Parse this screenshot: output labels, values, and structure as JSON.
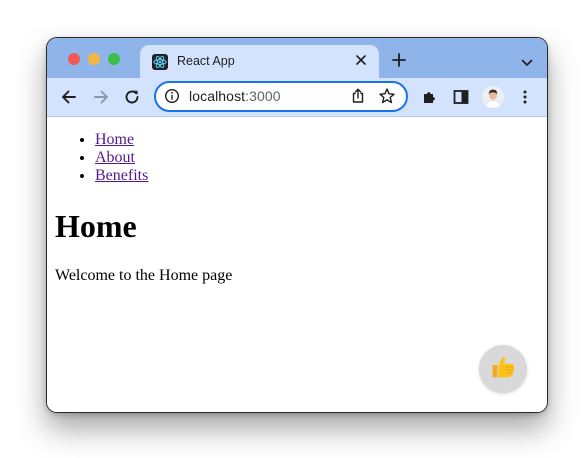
{
  "browser": {
    "tab": {
      "title": "React App",
      "favicon": "react-logo-icon",
      "close_icon": "close-icon"
    },
    "new_tab_icon": "plus-icon",
    "tab_menu_icon": "chevron-down-icon",
    "toolbar": {
      "back_icon": "back-arrow-icon",
      "forward_icon": "forward-arrow-icon",
      "reload_icon": "reload-icon",
      "extensions_icon": "puzzle-icon",
      "side_panel_icon": "side-panel-icon",
      "menu_icon": "kebab-menu-icon"
    },
    "omnibox": {
      "host": "localhost",
      "port": ":3000",
      "info_icon": "info-icon",
      "share_icon": "share-icon",
      "bookmark_icon": "star-icon"
    },
    "accent_color": "#1a73e8",
    "tabstrip_color": "#8fb4ea",
    "toolbar_color": "#d3e3fd"
  },
  "page": {
    "nav": {
      "links": [
        {
          "label": "Home"
        },
        {
          "label": "About"
        },
        {
          "label": "Benefits"
        }
      ],
      "link_color": "#551a8b"
    },
    "heading": "Home",
    "text": "Welcome to the Home page",
    "fab": {
      "icon": "thumbs-up-icon",
      "background": "#d9d9d9"
    }
  }
}
